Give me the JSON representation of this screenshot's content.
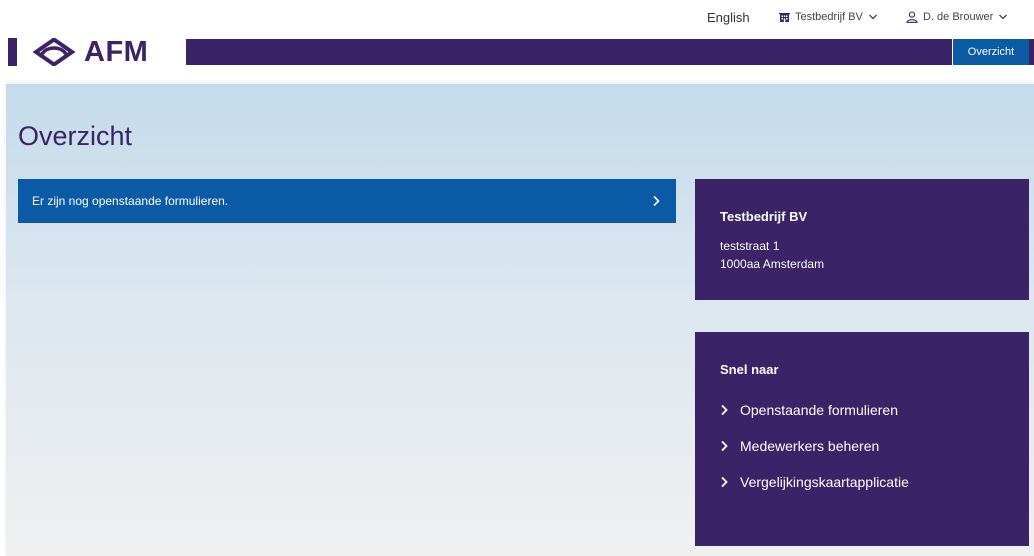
{
  "topbar": {
    "language": "English",
    "company": "Testbedrijf BV",
    "user": "D. de Brouwer"
  },
  "brand": {
    "logo_text": "AFM",
    "nav_active": "Overzicht"
  },
  "colors": {
    "brand_purple": "#3a2366",
    "accent_blue": "#0b5aa6"
  },
  "page": {
    "title": "Overzicht"
  },
  "notice": {
    "text": "Er zijn nog openstaande formulieren."
  },
  "company_card": {
    "name": "Testbedrijf BV",
    "street": "teststraat 1",
    "city": "1000aa Amsterdam"
  },
  "quick_links": {
    "title": "Snel naar",
    "items": [
      {
        "label": "Openstaande formulieren"
      },
      {
        "label": "Medewerkers beheren"
      },
      {
        "label": "Vergelijkingskaartapplicatie"
      }
    ]
  }
}
